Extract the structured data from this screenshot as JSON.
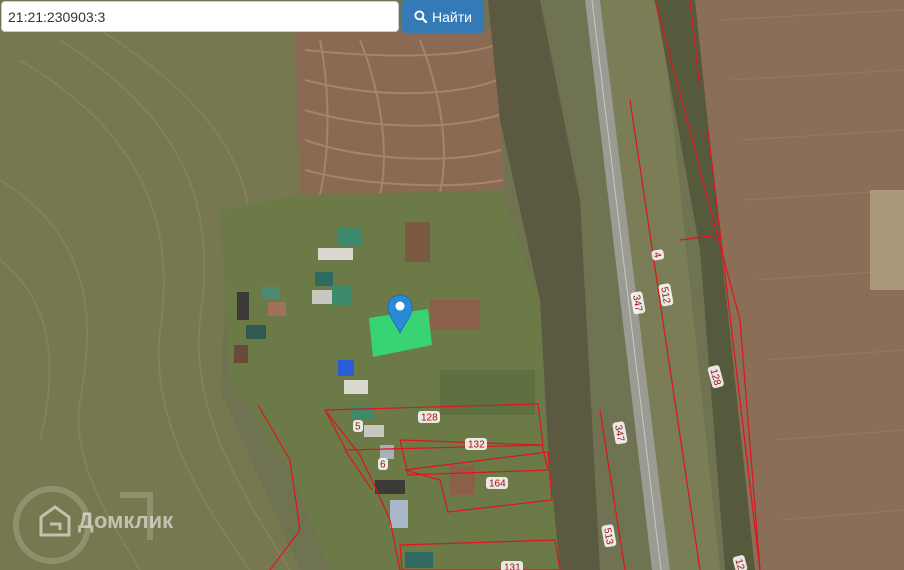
{
  "search": {
    "value": "21:21:230903:3",
    "button_label": "Найти",
    "button_icon": "search-icon",
    "button_color": "#337ab7"
  },
  "map": {
    "marker_icon": "map-pin-icon",
    "marker_color": "#2a8ad8",
    "highlight_color": "#2fe37a",
    "boundary_color": "#e0141e"
  },
  "parcel_labels": [
    "128",
    "132",
    "164",
    "131",
    "5",
    "6",
    "347",
    "512",
    "4",
    "128",
    "347",
    "513",
    "12"
  ],
  "watermark": {
    "brand": "Домклик",
    "logo_icon": "domclick-house-icon"
  }
}
